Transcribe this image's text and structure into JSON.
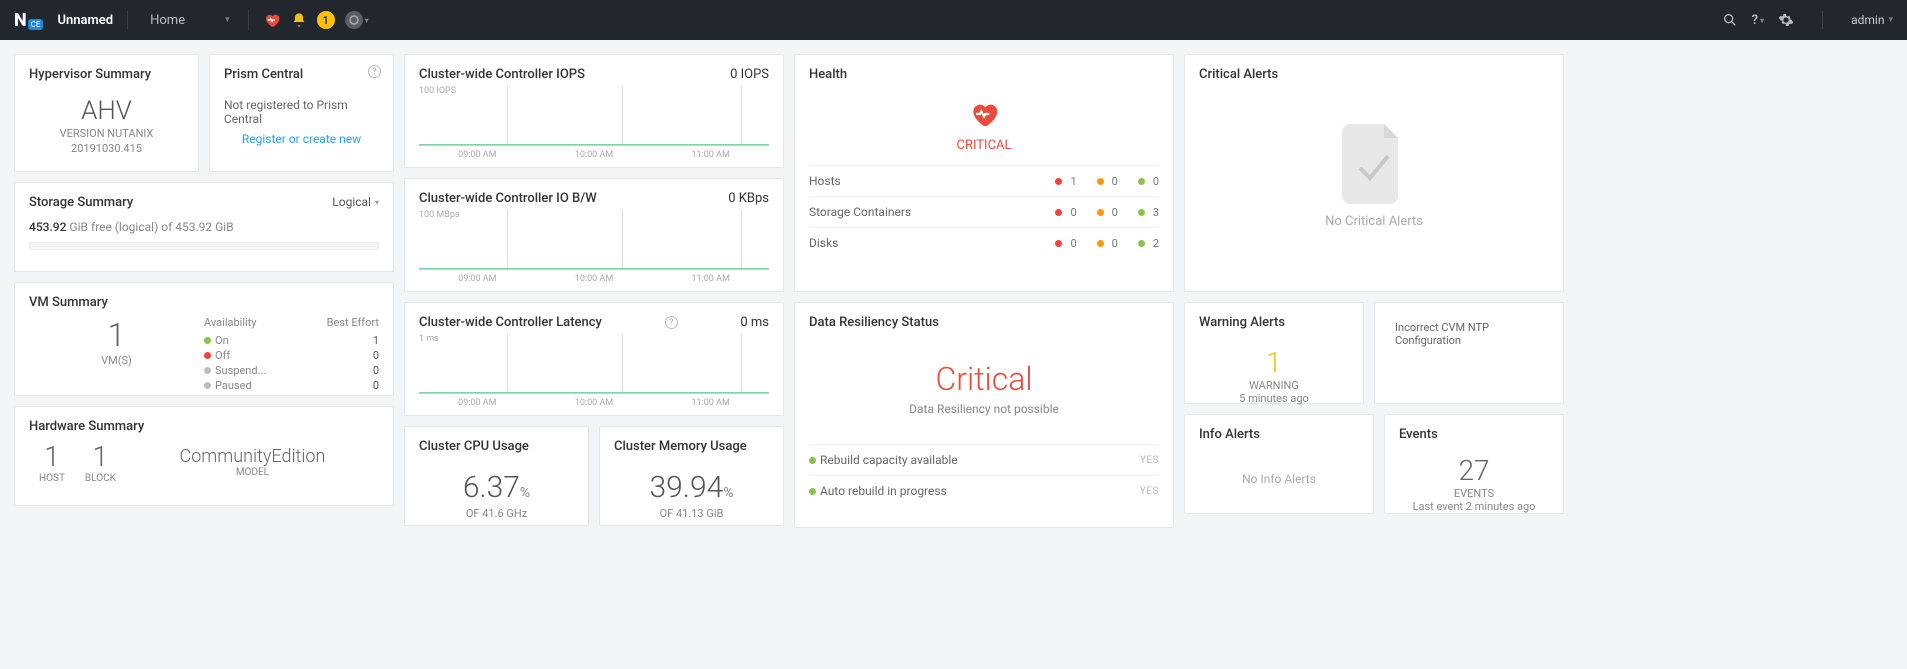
{
  "header": {
    "logo_text": "N",
    "logo_badge": "CE",
    "cluster_name": "Unnamed",
    "menu": "Home",
    "badge_count": "1",
    "user": "admin"
  },
  "hypervisor": {
    "title": "Hypervisor Summary",
    "name": "AHV",
    "version_line1": "VERSION NUTANIX",
    "version_line2": "20191030.415"
  },
  "prism_central": {
    "title": "Prism Central",
    "status": "Not registered to Prism Central",
    "link": "Register or create new"
  },
  "storage": {
    "title": "Storage Summary",
    "mode": "Logical",
    "free_value": "453.92",
    "free_unit": "GiB",
    "free_label": "free (logical) of 453.92 GiB"
  },
  "vm": {
    "title": "VM Summary",
    "count": "1",
    "count_label": "VM(S)",
    "col1": "Availability",
    "col2": "Best Effort",
    "rows": [
      {
        "label": "On",
        "val": "1",
        "color": "green"
      },
      {
        "label": "Off",
        "val": "0",
        "color": "red"
      },
      {
        "label": "Suspend...",
        "val": "0",
        "color": "grey"
      },
      {
        "label": "Paused",
        "val": "0",
        "color": "grey"
      }
    ]
  },
  "hardware": {
    "title": "Hardware Summary",
    "host_count": "1",
    "host_label": "HOST",
    "block_count": "1",
    "block_label": "BLOCK",
    "model": "CommunityEdition",
    "model_label": "MODEL"
  },
  "chart_iops": {
    "title": "Cluster-wide Controller IOPS",
    "value": "0 IOPS",
    "ylabel": "100 IOPS",
    "xlabels": [
      "09:00 AM",
      "10:00 AM",
      "11:00 AM"
    ]
  },
  "chart_iobw": {
    "title": "Cluster-wide Controller IO B/W",
    "value": "0 KBps",
    "ylabel": "100 MBps",
    "xlabels": [
      "09:00 AM",
      "10:00 AM",
      "11:00 AM"
    ]
  },
  "chart_latency": {
    "title": "Cluster-wide Controller Latency",
    "value": "0 ms",
    "ylabel": "1 ms",
    "xlabels": [
      "09:00 AM",
      "10:00 AM",
      "11:00 AM"
    ]
  },
  "cpu": {
    "title": "Cluster CPU Usage",
    "value": "6.37",
    "pct": "%",
    "sub": "OF 41.6 GHz"
  },
  "mem": {
    "title": "Cluster Memory Usage",
    "value": "39.94",
    "pct": "%",
    "sub": "OF 41.13 GiB"
  },
  "health": {
    "title": "Health",
    "status": "CRITICAL",
    "rows": [
      {
        "label": "Hosts",
        "red": "1",
        "orange": "0",
        "green": "0"
      },
      {
        "label": "Storage Containers",
        "red": "0",
        "orange": "0",
        "green": "3"
      },
      {
        "label": "Disks",
        "red": "0",
        "orange": "0",
        "green": "2"
      }
    ]
  },
  "resiliency": {
    "title": "Data Resiliency Status",
    "status": "Critical",
    "sub": "Data Resiliency not possible",
    "rows": [
      {
        "label": "Rebuild capacity available",
        "val": "YES"
      },
      {
        "label": "Auto rebuild in progress",
        "val": "YES"
      }
    ]
  },
  "critical_alerts": {
    "title": "Critical Alerts",
    "text": "No Critical Alerts"
  },
  "warning_alerts": {
    "title": "Warning Alerts",
    "count": "1",
    "label": "WARNING",
    "time": "5 minutes ago",
    "message": "Incorrect CVM NTP Configuration"
  },
  "info_alerts": {
    "title": "Info Alerts",
    "text": "No Info Alerts"
  },
  "events": {
    "title": "Events",
    "count": "27",
    "label": "EVENTS",
    "time": "Last event 2 minutes ago"
  },
  "chart_data": [
    {
      "type": "line",
      "title": "Cluster-wide Controller IOPS",
      "x": [
        "09:00",
        "10:00",
        "11:00"
      ],
      "values": [
        0,
        0,
        0
      ],
      "ylabel": "IOPS",
      "ylim": [
        0,
        100
      ]
    },
    {
      "type": "line",
      "title": "Cluster-wide Controller IO B/W",
      "x": [
        "09:00",
        "10:00",
        "11:00"
      ],
      "values": [
        0,
        0,
        0
      ],
      "ylabel": "MBps",
      "ylim": [
        0,
        100
      ]
    },
    {
      "type": "line",
      "title": "Cluster-wide Controller Latency",
      "x": [
        "09:00",
        "10:00",
        "11:00"
      ],
      "values": [
        0,
        0,
        0
      ],
      "ylabel": "ms",
      "ylim": [
        0,
        1
      ]
    }
  ]
}
